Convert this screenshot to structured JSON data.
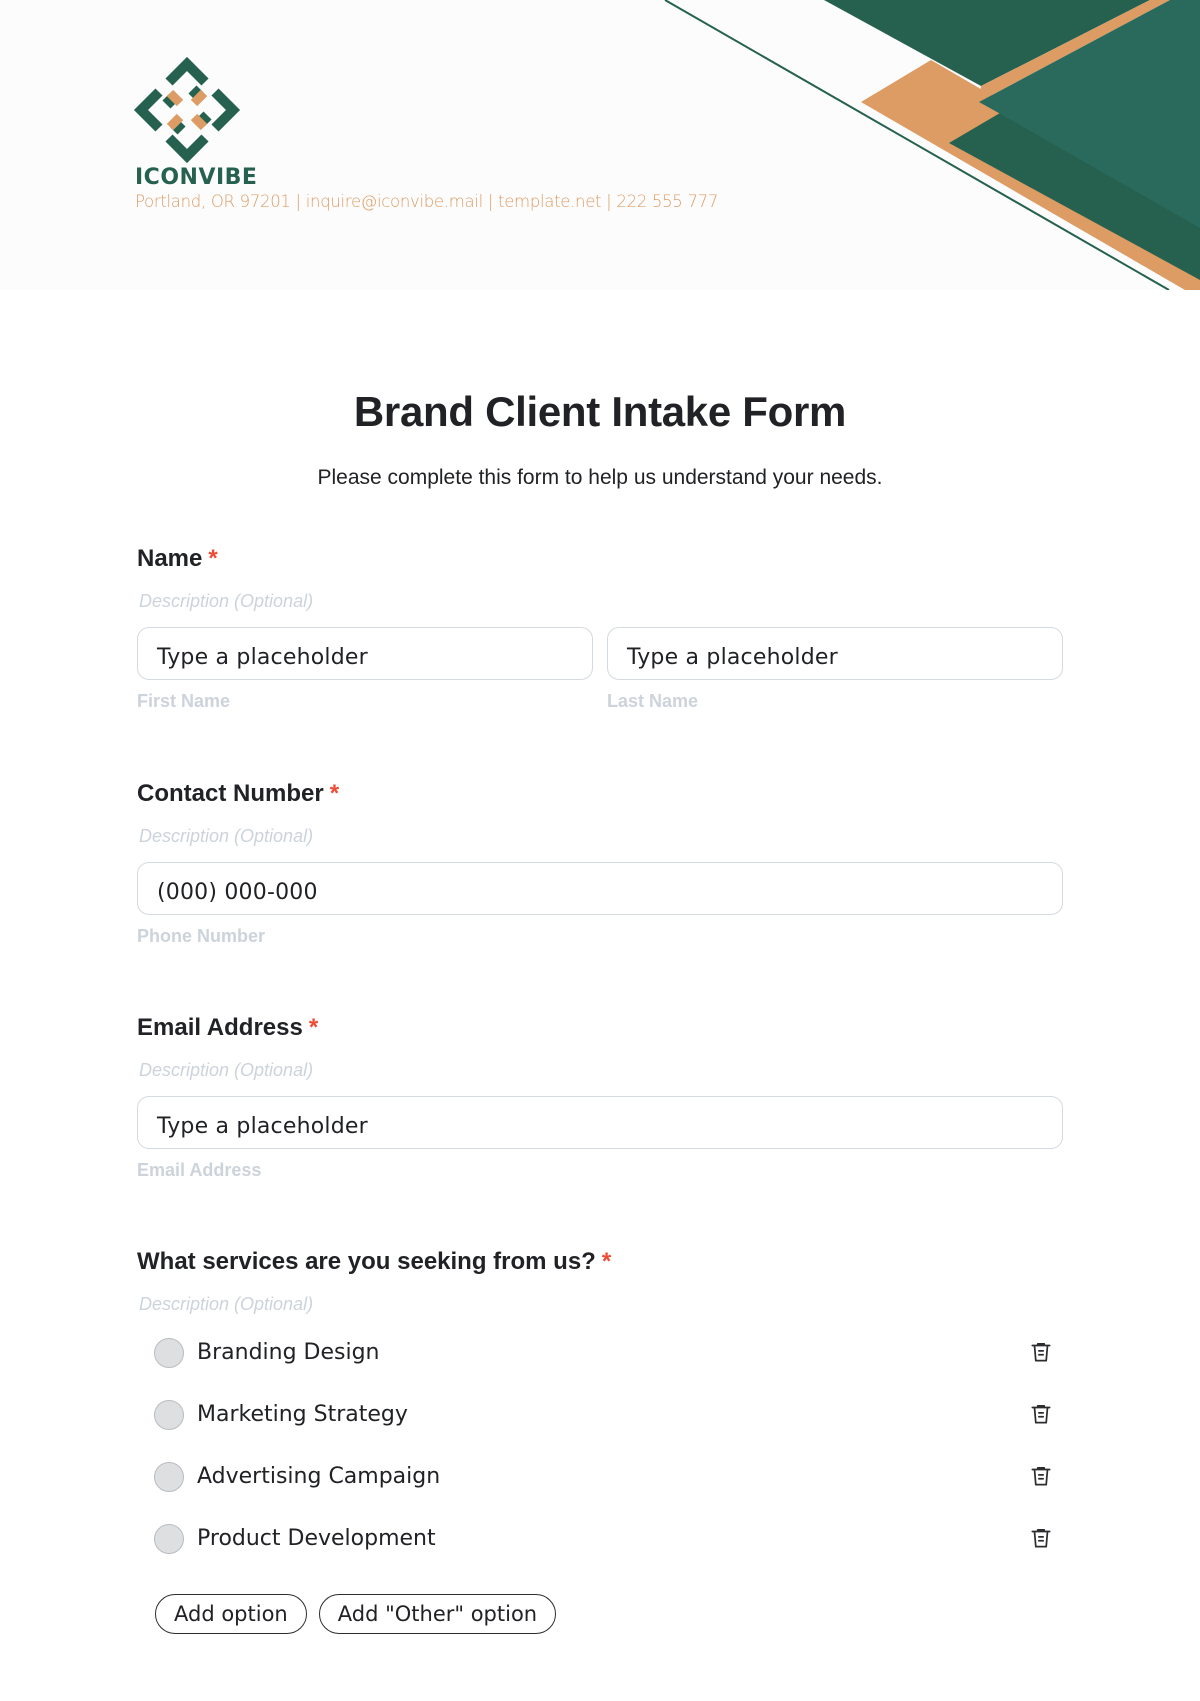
{
  "brand": {
    "name": "ICONVIBE",
    "contact_line": "Portland, OR 97201 | inquire@iconvibe.mail | template.net | 222 555 777",
    "colors": {
      "green": "#266150",
      "green_light": "#2a6a5c",
      "orange": "#dc9c63",
      "required": "#ef4a34"
    }
  },
  "form": {
    "title": "Brand Client Intake Form",
    "subtitle": "Please complete this form to help us understand your needs.",
    "required_mark": "*",
    "questions": [
      {
        "label": "Name",
        "description_placeholder": "Description (Optional)",
        "inputs": [
          {
            "placeholder": "Type a placeholder",
            "helper": "First Name"
          },
          {
            "placeholder": "Type a placeholder",
            "helper": "Last Name"
          }
        ]
      },
      {
        "label": "Contact Number",
        "description_placeholder": "Description (Optional)",
        "inputs": [
          {
            "placeholder": "(000) 000-000",
            "helper": "Phone Number"
          }
        ]
      },
      {
        "label": "Email Address",
        "description_placeholder": "Description (Optional)",
        "inputs": [
          {
            "placeholder": "Type a placeholder",
            "helper": "Email Address"
          }
        ]
      },
      {
        "label": "What services are you seeking from us?",
        "description_placeholder": "Description (Optional)",
        "options": [
          {
            "label": "Branding Design",
            "icon": "trash-icon"
          },
          {
            "label": "Marketing Strategy",
            "icon": "trash-icon"
          },
          {
            "label": "Advertising Campaign",
            "icon": "trash-icon"
          },
          {
            "label": "Product Development",
            "icon": "trash-icon"
          }
        ],
        "add_option_label": "Add option",
        "add_other_option_label": "Add \"Other\" option"
      }
    ]
  }
}
